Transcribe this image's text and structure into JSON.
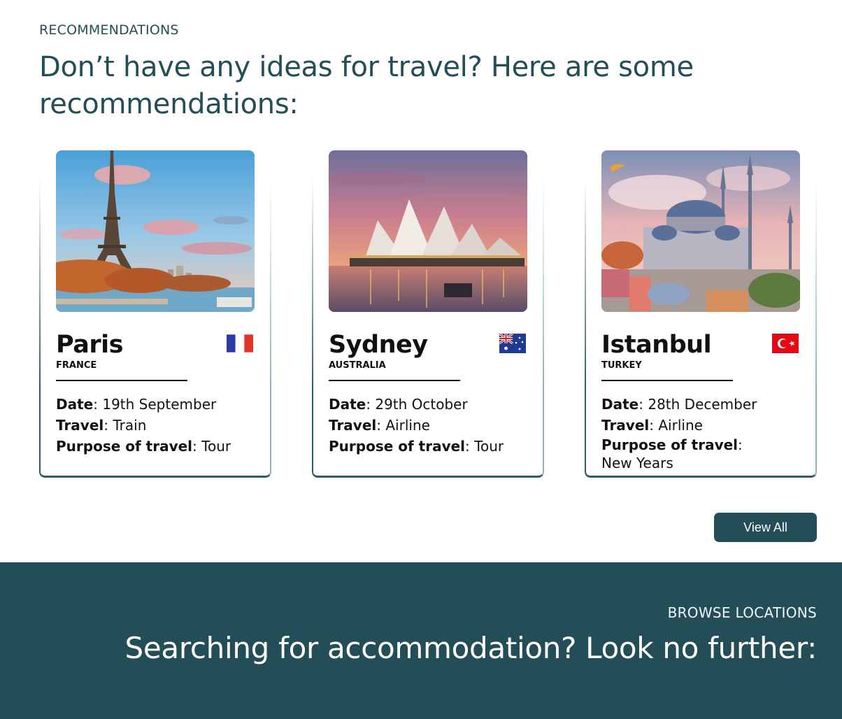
{
  "recommendations": {
    "eyebrow": "RECOMMENDATIONS",
    "headline": "Don’t have any ideas for travel? Here are some recommendations:"
  },
  "labels": {
    "date": "Date",
    "travel": "Travel",
    "purpose": "Purpose of travel"
  },
  "cards": [
    {
      "city": "Paris",
      "country": "FRANCE",
      "flag": "france-flag-icon",
      "date": "19th September",
      "travel": "Train",
      "purpose": "Tour"
    },
    {
      "city": "Sydney",
      "country": "AUSTRALIA",
      "flag": "australia-flag-icon",
      "date": "29th October",
      "travel": "Airline",
      "purpose": "Tour"
    },
    {
      "city": "Istanbul",
      "country": "TURKEY",
      "flag": "turkey-flag-icon",
      "date": "28th December",
      "travel": "Airline",
      "purpose": "New Years"
    }
  ],
  "view_all_label": "View All",
  "browse": {
    "eyebrow": "BROWSE LOCATIONS",
    "headline": "Searching for accommodation? Look no further:"
  },
  "colors": {
    "brand": "#234e57",
    "france_blue": "#2b3aa5",
    "france_red": "#e1342b",
    "turkey_red": "#e30a17"
  }
}
